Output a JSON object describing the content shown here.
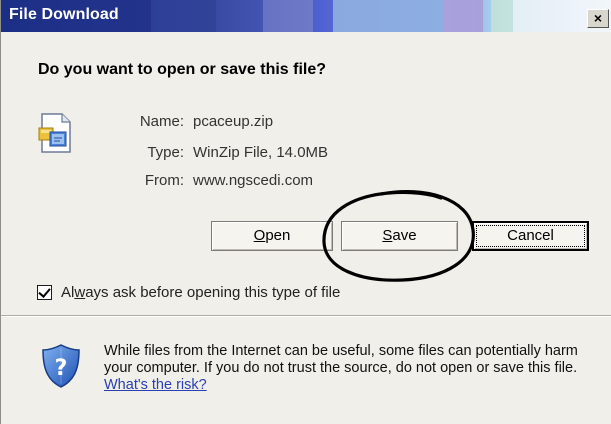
{
  "window": {
    "title": "File Download",
    "close_label": "×"
  },
  "prompt": {
    "question": "Do you want to open or save this file?"
  },
  "file_info": {
    "name_label": "Name:",
    "name_value": "pcaceup.zip",
    "type_label": "Type:",
    "type_value": "WinZip File, 14.0MB",
    "from_label": "From:",
    "from_value": "www.ngscedi.com"
  },
  "buttons": {
    "open_access_key": "O",
    "open_rest": "pen",
    "save_access_key": "S",
    "save_rest": "ave",
    "cancel_label": "Cancel"
  },
  "checkbox": {
    "checked": true,
    "label_prefix": "Al",
    "label_access_key": "w",
    "label_rest": "ays ask before opening this type of file"
  },
  "warning": {
    "text": "While files from the Internet can be useful, some files can potentially harm your computer. If you do not trust the source, do not open or save this file.",
    "link_text": "What's the risk?"
  },
  "icons": {
    "file": "winzip-file-icon",
    "shield": "security-shield-question-icon",
    "annotation": "hand-drawn-ellipse-annotation"
  },
  "colors": {
    "title_text": "#ffffff",
    "dialog_bg": "#f0efe9",
    "link": "#2a3fb3"
  }
}
